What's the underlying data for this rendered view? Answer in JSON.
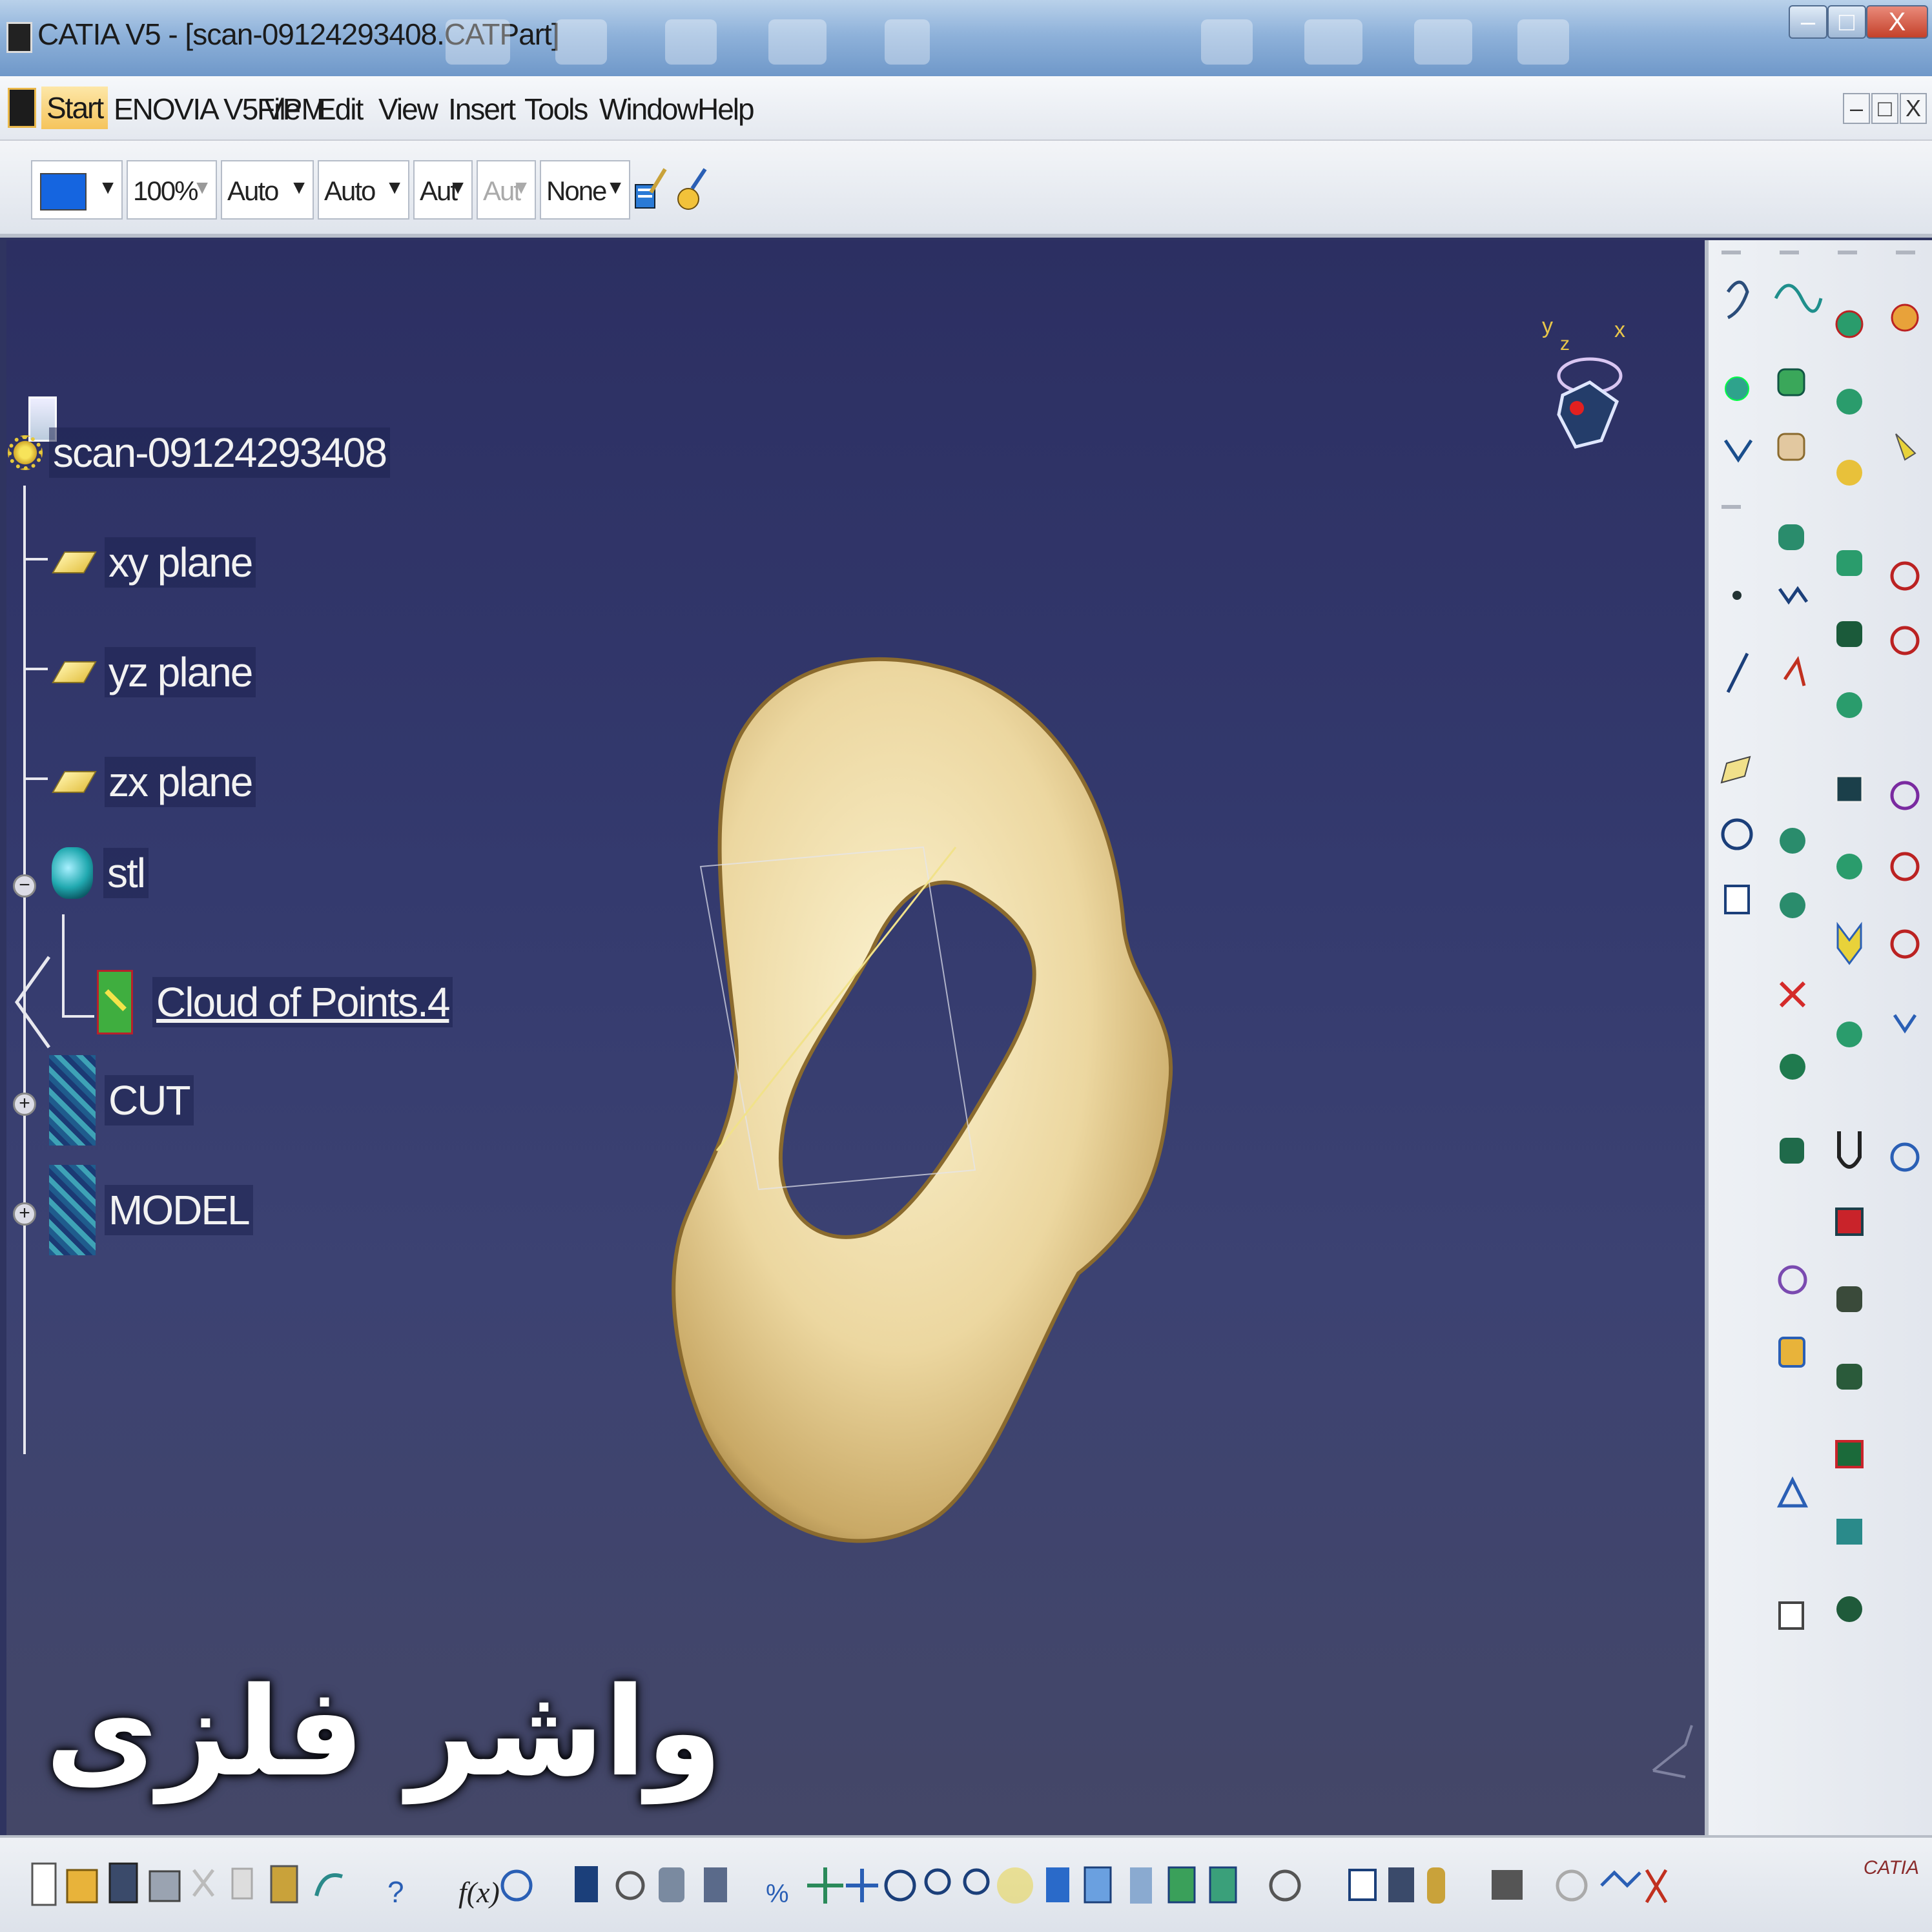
{
  "window": {
    "title": "CATIA V5 - [scan-09124293408.CATPart]",
    "controls": [
      "–",
      "□",
      "X"
    ]
  },
  "menu": {
    "items": [
      "Start",
      "ENOVIA V5 VPM",
      "File",
      "Edit",
      "View",
      "Insert",
      "Tools",
      "Window",
      "Help"
    ],
    "mdi_controls": [
      "–",
      "□",
      "X"
    ]
  },
  "toolbar": {
    "color_swatch": "#1565e0",
    "transparency": "100%",
    "linetype": "Auto",
    "thickness": "Auto",
    "point_symbol": "Aut",
    "layer_disabled": "Aut",
    "layer": "None"
  },
  "tree": {
    "root": "scan-09124293408",
    "planes": [
      "xy plane",
      "yz plane",
      "zx plane"
    ],
    "geo_set": "stl",
    "cloud": "Cloud of Points.4",
    "bodies": [
      "CUT",
      "MODEL"
    ]
  },
  "axis": {
    "y": "y",
    "z": "z",
    "x": "x"
  },
  "overlay_text": "واشر فلزی",
  "brand": "CATIA",
  "colors": {
    "viewport_top": "#2c2f62",
    "viewport_bottom": "#444767",
    "washer": "#e9d39c",
    "washer_edge": "#8a6a2e"
  }
}
